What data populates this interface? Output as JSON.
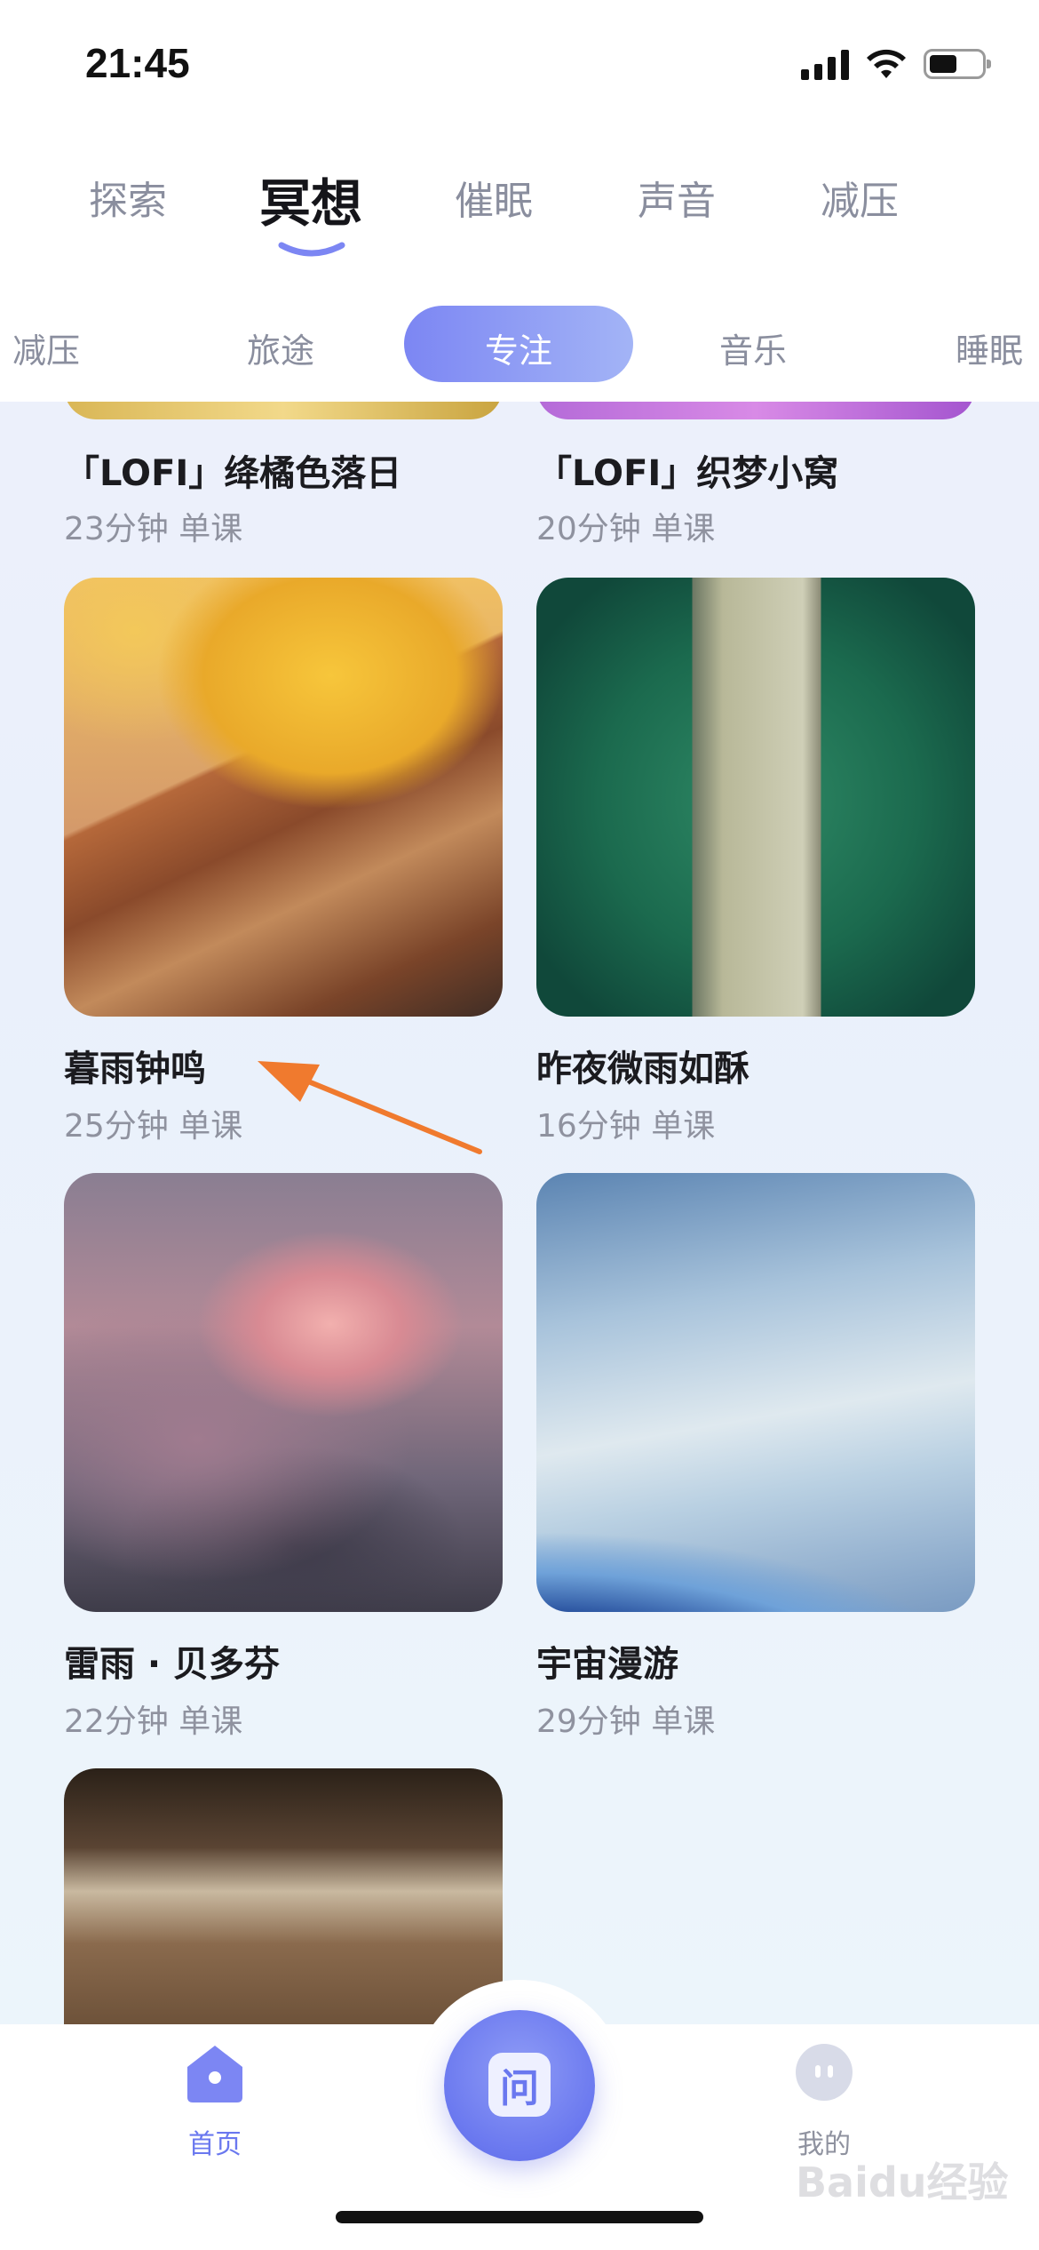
{
  "status_bar": {
    "time": "21:45"
  },
  "main_tabs": [
    "探索",
    "冥想",
    "催眠",
    "声音",
    "减压"
  ],
  "main_tab_active": 1,
  "sub_tabs": [
    "减压",
    "旅途",
    "专注",
    "音乐",
    "睡眠"
  ],
  "sub_tab_active": 2,
  "cards": [
    {
      "title": "「LOFI」绛橘色落日",
      "meta": "23分钟 单课"
    },
    {
      "title": "「LOFI」织梦小窝",
      "meta": "20分钟 单课"
    },
    {
      "title": "暮雨钟鸣",
      "meta": "25分钟 单课"
    },
    {
      "title": "昨夜微雨如酥",
      "meta": "16分钟 单课"
    },
    {
      "title": "雷雨 · 贝多芬",
      "meta": "22分钟 单课"
    },
    {
      "title": "宇宙漫游",
      "meta": "29分钟 单课"
    }
  ],
  "bottom_nav": {
    "home_label": "首页",
    "center_glyph": "问",
    "profile_label": "我的"
  },
  "watermark": "Baidu经验",
  "colors": {
    "accent": "#6a78ef",
    "pill_start": "#7c86f3",
    "pill_end": "#a3b4f6",
    "annotation_arrow": "#f07a2e"
  }
}
